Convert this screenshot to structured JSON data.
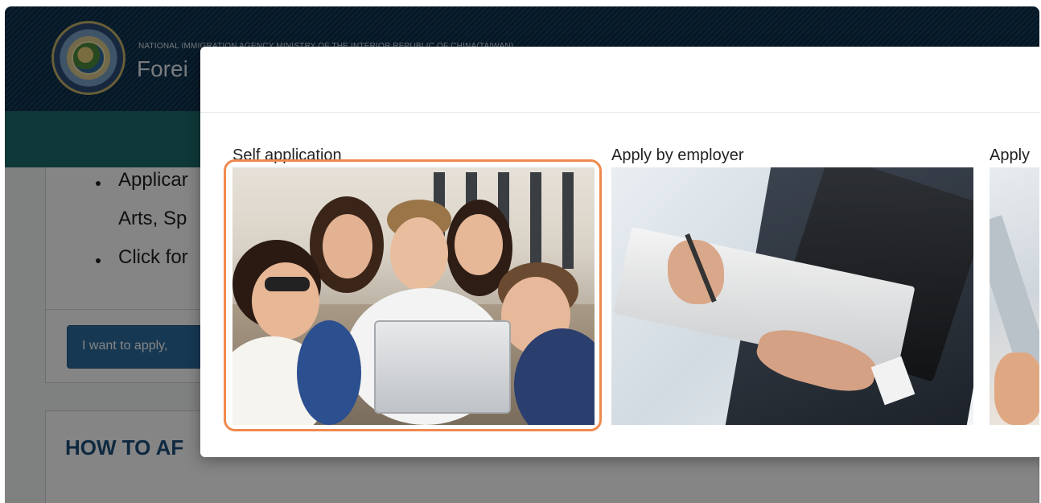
{
  "site": {
    "agency_name": "NATIONAL IMMIGRATION AGENCY MINISTRY OF THE INTERIOR REPUBLIC OF CHINA(TAIWAN)",
    "title_partial": "Forei",
    "logo_icon": "agency-seal-icon"
  },
  "content": {
    "bullets": [
      "Applicar",
      "Arts, Sp",
      "Click for"
    ],
    "apply_button": "I want to apply,",
    "how_title": "HOW TO AF"
  },
  "modal": {
    "options": [
      {
        "label": "Self application",
        "image": "students-with-laptop-photo",
        "highlighted": true
      },
      {
        "label": "Apply by employer",
        "image": "businessman-signing-document-photo",
        "highlighted": false
      },
      {
        "label": "Apply",
        "image": "partial-photo",
        "highlighted": false
      }
    ]
  },
  "colors": {
    "header_bg": "#0d2c48",
    "nav_bg": "#1d6b6c",
    "button_bg": "#2c6c9e",
    "heading": "#1b4f7c",
    "highlight": "#ef8a4f"
  }
}
